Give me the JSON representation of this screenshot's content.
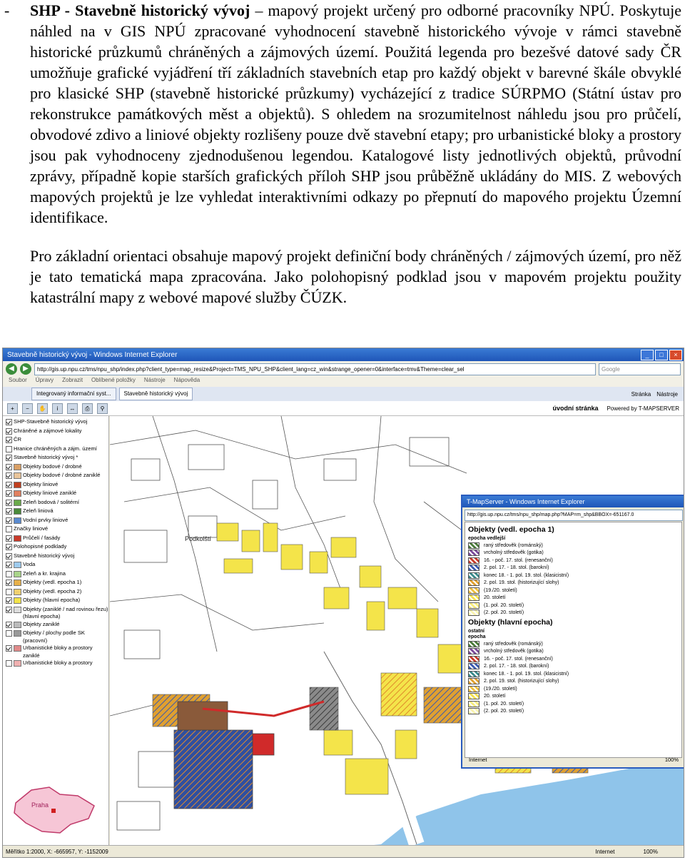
{
  "document": {
    "bullet": "-",
    "para1_title": "SHP - Stavebně historický vývoj",
    "para1_text": "– mapový projekt určený pro odborné pracovníky NPÚ. Poskytuje náhled na v GIS NPÚ zpracované vyhodnocení stavebně historického vývoje v rámci stavebně historické průzkumů chráněných a zájmových území. Použitá legenda pro bezešvé datové sady ČR umožňuje grafické vyjádření tří základních stavebních etap pro každý objekt v barevné škále obvyklé pro klasické SHP (stavebně historické průzkumy) vycházející z tradice SÚRPMO (Státní ústav pro rekonstrukce památkových měst a objektů). S ohledem na srozumitelnost náhledu jsou pro průčelí, obvodové zdivo a liniové objekty rozlišeny pouze dvě stavební etapy; pro urbanistické bloky a prostory jsou pak vyhodnoceny zjednodušenou legendou. Katalogové listy jednotlivých objektů, průvodní zprávy, případně kopie starších grafických příloh SHP jsou průběžně ukládány do MIS. Z webových mapových projektů je lze vyhledat interaktivními odkazy po přepnutí do mapového projektu Územní identifikace.",
    "para2_text": "Pro základní orientaci obsahuje mapový projekt definiční body chráněných / zájmových území, pro něž je tato tematická mapa zpracována. Jako polohopisný podklad jsou v mapovém projektu použity katastrální mapy z webové mapové služby ČÚZK."
  },
  "browser": {
    "title": "Stavebně historický vývoj - Windows Internet Explorer",
    "url": "http://gis.up.npu.cz/tms/npu_shp/index.php?client_type=map_resize&Project=TMS_NPU_SHP&client_lang=cz_win&strange_opener=0&interface=tmv&Theme=clear_sel",
    "search_placeholder": "Google",
    "menu": [
      "Soubor",
      "Úpravy",
      "Zobrazit",
      "Oblíbené položky",
      "Nástroje",
      "Nápověda"
    ],
    "tabs": [
      "Integrovaný informační syst...",
      "Stavebně historický vývoj"
    ],
    "tab_tools": [
      "Stránka",
      "Nástroje"
    ],
    "home_link": "úvodní stránka",
    "powered_by": "Powered by T-MAPSERVER",
    "status_left": "Měřítko 1:2000, X: -665957, Y: -1152009",
    "status_zone": "Internet",
    "status_zoom": "100%"
  },
  "layers": [
    {
      "label": "SHP-Stavebně historický vývoj",
      "checked": true,
      "swatch": ""
    },
    {
      "label": "Chráněné a zájmové lokality",
      "checked": true,
      "swatch": ""
    },
    {
      "label": "ČR",
      "checked": true,
      "swatch": ""
    },
    {
      "label": "Hranice chráněných a zájm. území",
      "checked": false,
      "swatch": ""
    },
    {
      "label": "Stavebně historický vývoj *",
      "checked": true,
      "swatch": ""
    },
    {
      "label": "Objekty bodové / drobné",
      "checked": true,
      "swatch": "#d9a066"
    },
    {
      "label": "Objekty bodové / drobné zaniklé",
      "checked": true,
      "swatch": "#e8c49a"
    },
    {
      "label": "Objekty liniové",
      "checked": true,
      "swatch": "#c04020"
    },
    {
      "label": "Objekty liniové zaniklé",
      "checked": true,
      "swatch": "#e08060"
    },
    {
      "label": "Zeleň bodová / solitérní",
      "checked": true,
      "swatch": "#6aaa4a"
    },
    {
      "label": "Zeleň liniová",
      "checked": true,
      "swatch": "#4a8a3a"
    },
    {
      "label": "Vodní prvky liniové",
      "checked": true,
      "swatch": "#5a8ad0"
    },
    {
      "label": "Značky liniové",
      "checked": false,
      "swatch": ""
    },
    {
      "label": "Průčelí / fasády",
      "checked": true,
      "swatch": "#c83a2a"
    },
    {
      "label": "Polohopisné podklady",
      "checked": true,
      "swatch": ""
    },
    {
      "label": "Stavebně historický vývoj",
      "checked": true,
      "swatch": ""
    },
    {
      "label": "Voda",
      "checked": true,
      "swatch": "#9ecbee"
    },
    {
      "label": "Zeleň a kr. krajina",
      "checked": false,
      "swatch": "#a9d48a"
    },
    {
      "label": "Objekty (vedl. epocha 1)",
      "checked": true,
      "swatch": "#e6b04a"
    },
    {
      "label": "Objekty (vedl. epocha 2)",
      "checked": false,
      "swatch": "#f0d070"
    },
    {
      "label": "Objekty (hlavní epocha)",
      "checked": true,
      "swatch": "#f2e34a"
    },
    {
      "label": "Objekty (zaniklé / nad rovinou řezu) (hlavní epocha)",
      "checked": true,
      "swatch": "#ddd"
    },
    {
      "label": "Objekty zaniklé",
      "checked": true,
      "swatch": "#bbb"
    },
    {
      "label": "Objekty / plochy podle SK (pracovní)",
      "checked": false,
      "swatch": "#999"
    },
    {
      "label": "Urbanistické bloky a prostory zaniklé",
      "checked": true,
      "swatch": "#e08a8a"
    },
    {
      "label": "Urbanistické bloky a prostory",
      "checked": false,
      "swatch": "#f0b0b0"
    }
  ],
  "minimap_label": "Praha",
  "popup": {
    "title": "T-MapServer - Windows Internet Explorer",
    "url": "http://gis.up.npu.cz/tms/npu_shp/map.php?MAP=m_shp&BBOX=-651167.0",
    "heading1": "Objekty (vedl. epocha 1)",
    "sub1": "epocha vedlejší",
    "legend1": [
      {
        "label": "raný středověk (románský)",
        "color": "#4a7a3a"
      },
      {
        "label": "vrcholný středověk (gotika)",
        "color": "#7a4a9a"
      },
      {
        "label": "16. - poč. 17. stol. (renesanční)",
        "color": "#c83a2a"
      },
      {
        "label": "2. pol. 17. - 18. stol. (barokní)",
        "color": "#3a5ab0"
      },
      {
        "label": "konec 18. - 1. pol. 19. stol. (klasicistní)",
        "color": "#3a8a8a"
      },
      {
        "label": "2. pol. 19. stol. (historizující slohy)",
        "color": "#e0a030"
      },
      {
        "label": "(19./20. století)",
        "color": "#f0c040"
      },
      {
        "label": "20. století",
        "color": "#f5e050"
      },
      {
        "label": "(1. pol. 20. století)",
        "color": "#f8ec80"
      },
      {
        "label": "(2. pol. 20. století)",
        "color": "#fbf4b0"
      }
    ],
    "heading2": "Objekty (hlavní epocha)",
    "sub2a": "ostatní",
    "sub2b": "epocha",
    "legend2": [
      {
        "label": "raný středověk (románský)",
        "color": "#4a7a3a"
      },
      {
        "label": "vrcholný středověk (gotika)",
        "color": "#7a4a9a"
      },
      {
        "label": "16. - poč. 17. stol. (renesanční)",
        "color": "#c83a2a"
      },
      {
        "label": "2. pol. 17. - 18. stol. (barokní)",
        "color": "#3a5ab0"
      },
      {
        "label": "konec 18. - 1. pol. 19. stol. (klasicistní)",
        "color": "#3a8a8a"
      },
      {
        "label": "2. pol. 19. stol. (historizující slohy)",
        "color": "#e0a030"
      },
      {
        "label": "(19./20. století)",
        "color": "#f0c040"
      },
      {
        "label": "20. století",
        "color": "#f5e050"
      },
      {
        "label": "(1. pol. 20. století)",
        "color": "#f8ec80"
      },
      {
        "label": "(2. pol. 20. století)",
        "color": "#fbf4b0"
      }
    ],
    "status_zone": "Internet",
    "status_zoom": "100%"
  },
  "map": {
    "place_label": "Podkolští",
    "colors": {
      "river": "#8fc4ea",
      "street": "#ffffff",
      "yellow": "#f4e44a",
      "orange": "#e09a3a",
      "blue": "#2f4fa0",
      "brown": "#8a5a3a",
      "red": "#d02a2a",
      "green": "#4a9a3a"
    }
  }
}
